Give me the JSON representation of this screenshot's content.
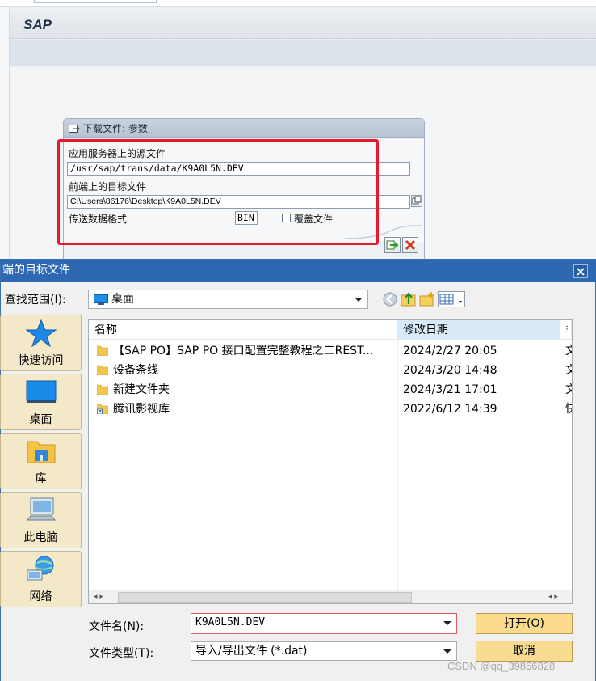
{
  "sap": {
    "title": "SAP"
  },
  "popup": {
    "title": "下载文件: 参数",
    "source_label": "应用服务器上的源文件",
    "source_value": "/usr/sap/trans/data/K9A0L5N.DEV",
    "target_label": "前端上的目标文件",
    "target_value": "C:\\Users\\86176\\Desktop\\K9A0L5N.DEV",
    "format_label": "传送数据格式",
    "format_value": "BIN",
    "overwrite_label": "覆盖文件",
    "overwrite_checked": false,
    "highlight_color": "#e8192c"
  },
  "dialog": {
    "title": "端的目标文件",
    "look_in_label": "查找范围(I):",
    "look_in_value": "桌面",
    "places": [
      {
        "label": "快速访问",
        "icon": "star-icon"
      },
      {
        "label": "桌面",
        "icon": "desktop-icon"
      },
      {
        "label": "库",
        "icon": "library-icon"
      },
      {
        "label": "此电脑",
        "icon": "computer-icon"
      },
      {
        "label": "网络",
        "icon": "network-icon"
      }
    ],
    "columns": {
      "name": "名称",
      "modified": "修改日期"
    },
    "files": [
      {
        "name": "【SAP PO】SAP PO 接口配置完整教程之二REST...",
        "modified": "2024/2/27 20:05",
        "type_cut": "文",
        "icon": "folder-icon"
      },
      {
        "name": "设备条线",
        "modified": "2024/3/20 14:48",
        "type_cut": "文",
        "icon": "folder-icon"
      },
      {
        "name": "新建文件夹",
        "modified": "2024/3/21 17:01",
        "type_cut": "文",
        "icon": "folder-icon"
      },
      {
        "name": "腾讯影视库",
        "modified": "2022/6/12 14:39",
        "type_cut": "快",
        "icon": "shortcut-folder-icon"
      }
    ],
    "filename_label": "文件名(N):",
    "filename_value": "K9A0L5N.DEV",
    "filetype_label": "文件类型(T):",
    "filetype_value": "导入/导出文件 (*.dat)",
    "open_button": "打开(O)",
    "cancel_button": "取消"
  },
  "watermark": "CSDN @qq_39866828"
}
